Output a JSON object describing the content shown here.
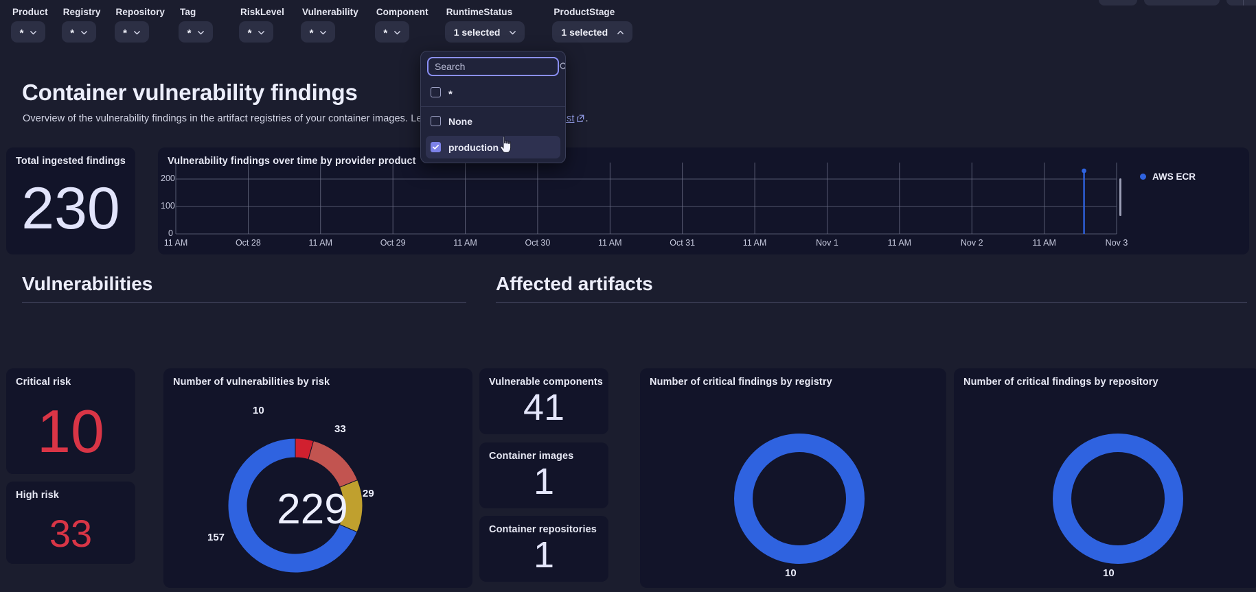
{
  "filters": [
    {
      "name": "Product",
      "label": "Product",
      "value": "*",
      "state": "collapsed"
    },
    {
      "name": "Registry",
      "label": "Registry",
      "value": "*",
      "state": "collapsed"
    },
    {
      "name": "Repository",
      "label": "Repository",
      "value": "*",
      "state": "collapsed"
    },
    {
      "name": "Tag",
      "label": "Tag",
      "value": "*",
      "state": "collapsed"
    },
    {
      "name": "RiskLevel",
      "label": "RiskLevel",
      "value": "*",
      "state": "collapsed"
    },
    {
      "name": "Vulnerability",
      "label": "Vulnerability",
      "value": "*",
      "state": "collapsed"
    },
    {
      "name": "Component",
      "label": "Component",
      "value": "*",
      "state": "collapsed"
    },
    {
      "name": "RuntimeStatus",
      "label": "RuntimeStatus",
      "value": "1 selected",
      "state": "collapsed"
    },
    {
      "name": "ProductStage",
      "label": "ProductStage",
      "value": "1 selected",
      "state": "expanded"
    }
  ],
  "dropdown": {
    "owner": "ProductStage",
    "search": {
      "placeholder": "Search",
      "value": "",
      "icon": "search-icon"
    },
    "options": [
      {
        "label": "*",
        "checked": false
      },
      {
        "label": "None",
        "checked": false
      },
      {
        "label": "production",
        "checked": true
      }
    ]
  },
  "header": {
    "title": "Container vulnerability findings",
    "description_before": "Overview of the vulnerability findings in the artifact registries of your container images. Learn more in the ",
    "link_text": "documentation list",
    "link_suffix": ".",
    "external_icon": "external-link-icon"
  },
  "sections": [
    {
      "title": "Vulnerabilities"
    },
    {
      "title": "Affected artifacts"
    }
  ],
  "cards": {
    "total_ingested": {
      "title": "Total ingested findings",
      "value": "230"
    },
    "critical_risk": {
      "title": "Critical risk",
      "value": "10",
      "color": "#d93546"
    },
    "high_risk": {
      "title": "High risk",
      "value": "33",
      "color": "#d93546"
    },
    "vulnerable_components": {
      "title": "Vulnerable components",
      "value": "41"
    },
    "container_images": {
      "title": "Container images",
      "value": "1"
    },
    "container_repositories": {
      "title": "Container repositories",
      "value": "1"
    }
  },
  "chart_data": [
    {
      "id": "vuln_over_time",
      "type": "line",
      "title": "Vulnerability findings over time by provider product",
      "xlabel": "",
      "ylabel": "",
      "ylim": [
        0,
        230
      ],
      "yticks": [
        "0",
        "100",
        "200"
      ],
      "grid": true,
      "legend": [
        "AWS ECR"
      ],
      "legend_position": "right",
      "series_colors": [
        "#2f63e0"
      ],
      "xticks": [
        "11 AM",
        "Oct 28",
        "11 AM",
        "Oct 29",
        "11 AM",
        "Oct 30",
        "11 AM",
        "Oct 31",
        "11 AM",
        "Nov 1",
        "11 AM",
        "Nov 2",
        "11 AM",
        "Nov 3"
      ],
      "series": [
        {
          "name": "AWS ECR",
          "points": [
            {
              "x": "Nov 2 ~21:00",
              "y": 230
            }
          ]
        }
      ],
      "annotation": "Single spike of 230 findings near Nov 3"
    },
    {
      "id": "vulns_by_risk",
      "type": "pie",
      "title": "Number of vulnerabilities by risk",
      "center_label": "229",
      "labels": [
        "10",
        "33",
        "29",
        "157"
      ],
      "values": [
        10,
        33,
        29,
        157
      ],
      "colors": [
        "#d1202f",
        "#c25450",
        "#c0a02e",
        "#2f63e0"
      ],
      "legend": [],
      "total": 229
    },
    {
      "id": "critical_by_registry",
      "type": "pie",
      "title": "Number of critical findings by registry",
      "labels": [
        "10"
      ],
      "values": [
        10
      ],
      "colors": [
        "#2f63e0"
      ],
      "total": 10
    },
    {
      "id": "critical_by_repository",
      "type": "pie",
      "title": "Number of critical findings by repository",
      "labels": [
        "10"
      ],
      "values": [
        10
      ],
      "colors": [
        "#2f63e0"
      ],
      "total": 10
    }
  ]
}
